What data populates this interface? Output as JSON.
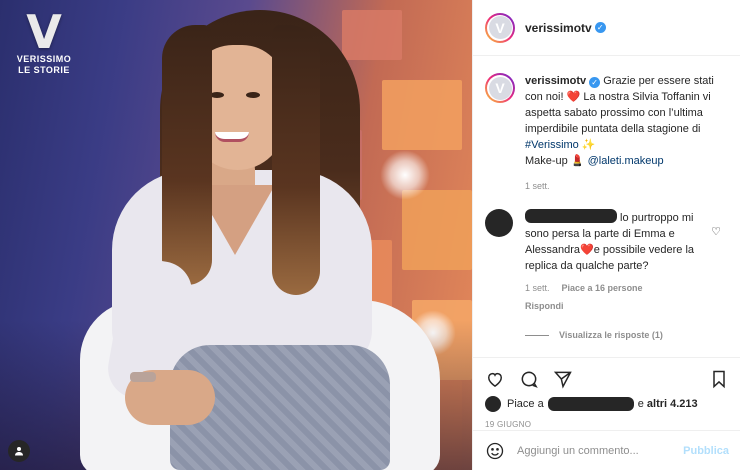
{
  "photo": {
    "logo_letter": "V",
    "logo_line1": "VERISSIMO",
    "logo_line2": "LE STORIE"
  },
  "header": {
    "username": "verissimotv",
    "verified": "✓",
    "avatar_letter": "V"
  },
  "caption": {
    "username": "verissimotv",
    "verified": "✓",
    "text_1": "Grazie per essere stati con noi! ",
    "heart": "❤️",
    "text_2": " La nostra Silvia Toffanin vi aspetta sabato prossimo con l’ultima imperdibile puntata della stagione di ",
    "hashtag": "#Verissimo",
    "sparkle": " ✨",
    "text_3": "Make-up ",
    "lipstick": "💄",
    "mention": " @laleti.makeup",
    "time": "1 sett."
  },
  "comment": {
    "text_1": " lo purtroppo mi sono persa la parte di Emma e Alessandra",
    "heart": "❤️",
    "text_2": "e possibile vedere la replica da qualche parte?",
    "time": "1 sett.",
    "likes": "Piace a 16 persone",
    "reply": "Rispondi",
    "view_replies": "Visualizza le risposte (1)"
  },
  "comment2": {
    "hearts": "❤️❤️❤️❤️❤️❤️❤️❤️"
  },
  "likes": {
    "prefix": "Piace a",
    "and_others": "e",
    "others_count": "altri 4.213"
  },
  "date": "19 GIUGNO",
  "add_comment": {
    "placeholder": "Aggiungi un commento...",
    "publish": "Pubblica"
  },
  "icons": {
    "like": "heart-outline",
    "comment": "speech-bubble",
    "share": "paper-plane",
    "save": "bookmark",
    "emoji": "smiley",
    "tag": "person"
  },
  "colors": {
    "verified": "#3897f0",
    "hashtag": "#00376b",
    "publish_disabled": "#b2dffc",
    "heart": "#ed4956"
  }
}
